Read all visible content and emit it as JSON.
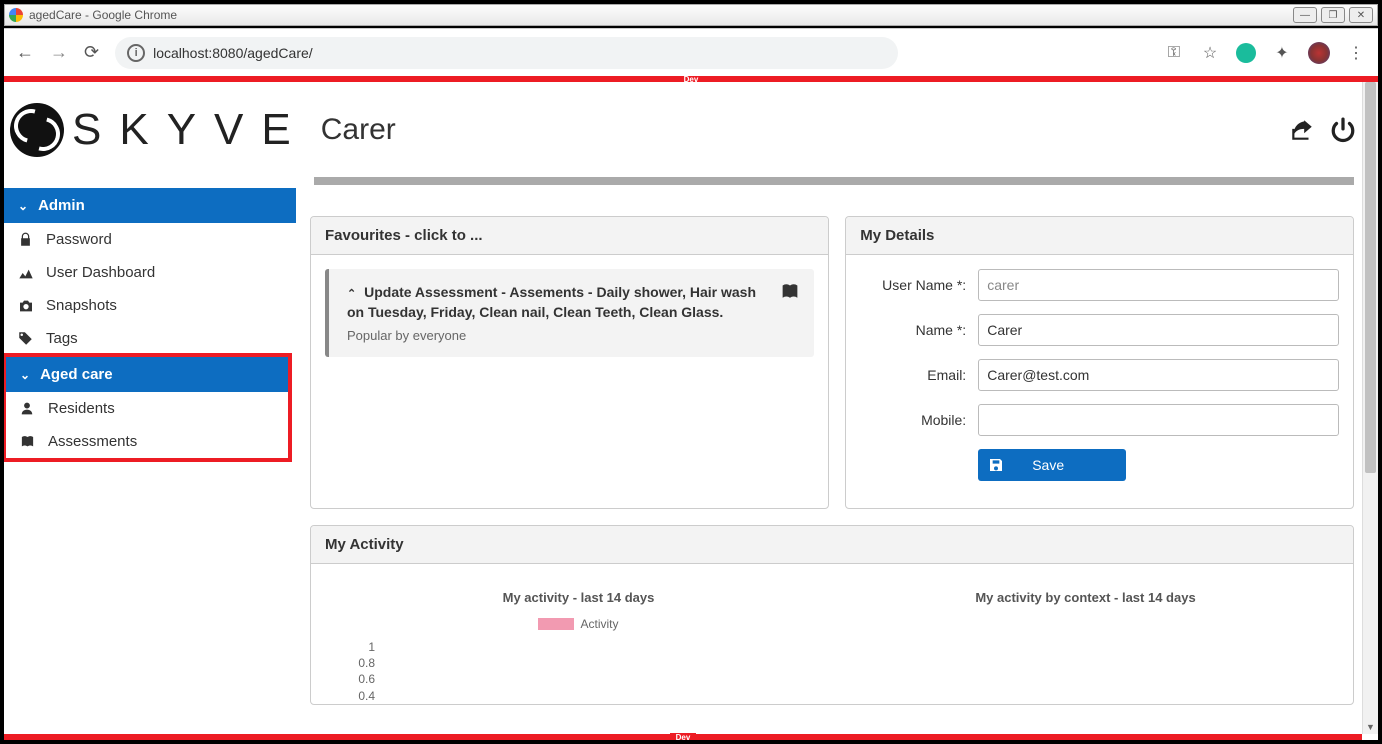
{
  "window": {
    "title": "agedCare - Google Chrome"
  },
  "browser": {
    "url": "localhost:8080/agedCare/",
    "dev_label": "Dev"
  },
  "app": {
    "logo_text": "SKYVE",
    "page_title": "Carer"
  },
  "sidebar": {
    "group_admin": "Admin",
    "items_admin": {
      "password": "Password",
      "dashboard": "User Dashboard",
      "snapshots": "Snapshots",
      "tags": "Tags"
    },
    "group_aged": "Aged care",
    "items_aged": {
      "residents": "Residents",
      "assessments": "Assessments"
    }
  },
  "favourites": {
    "panel_title": "Favourites - click to ...",
    "item_title": "Update Assessment - Assements - Daily shower, Hair wash on Tuesday, Friday, Clean nail, Clean Teeth, Clean Glass.",
    "item_sub": "Popular by everyone"
  },
  "details": {
    "panel_title": "My Details",
    "labels": {
      "username": "User Name *:",
      "name": "Name *:",
      "email": "Email:",
      "mobile": "Mobile:"
    },
    "values": {
      "username": "carer",
      "name": "Carer",
      "email": "Carer@test.com",
      "mobile": ""
    },
    "save_label": "Save"
  },
  "activity": {
    "panel_title": "My Activity",
    "col1_title": "My activity - last 14 days",
    "col2_title": "My activity by context - last 14 days",
    "legend_label": "Activity"
  },
  "chart_data": {
    "type": "bar",
    "title": "My activity - last 14 days",
    "series": [
      {
        "name": "Activity",
        "values": []
      }
    ],
    "ylim": [
      0,
      1.0
    ],
    "y_ticks": [
      1.0,
      0.8,
      0.6,
      0.4
    ]
  }
}
